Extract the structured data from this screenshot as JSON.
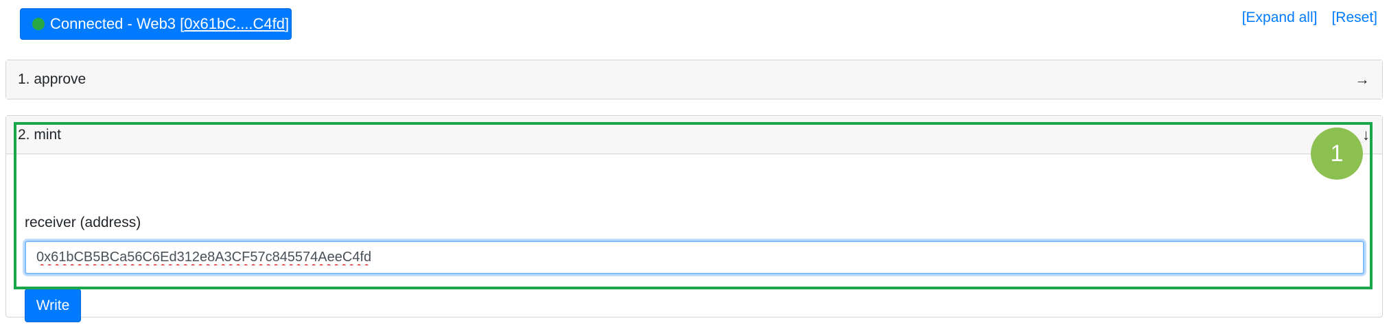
{
  "header": {
    "connection_label": "Connected - Web3 [",
    "connection_address": "0x61bC....C4fd",
    "connection_suffix": "]",
    "expand_all_label": "[Expand all]",
    "reset_label": "[Reset]"
  },
  "functions": [
    {
      "label": "1. approve",
      "state": "collapsed",
      "icon": "arrow-right-icon"
    },
    {
      "label": "2. mint",
      "state": "expanded",
      "icon": "arrow-down-icon",
      "params": [
        {
          "label": "receiver (address)",
          "value": "0x61bCB5BCa56C6Ed312e8A3CF57c845574AeeC4fd"
        }
      ],
      "write_label": "Write"
    }
  ],
  "annotation": {
    "badge": "1"
  },
  "colors": {
    "accent": "#007bff",
    "status": "#28a745",
    "highlight": "#1aa64b",
    "badge": "#8cc152"
  }
}
